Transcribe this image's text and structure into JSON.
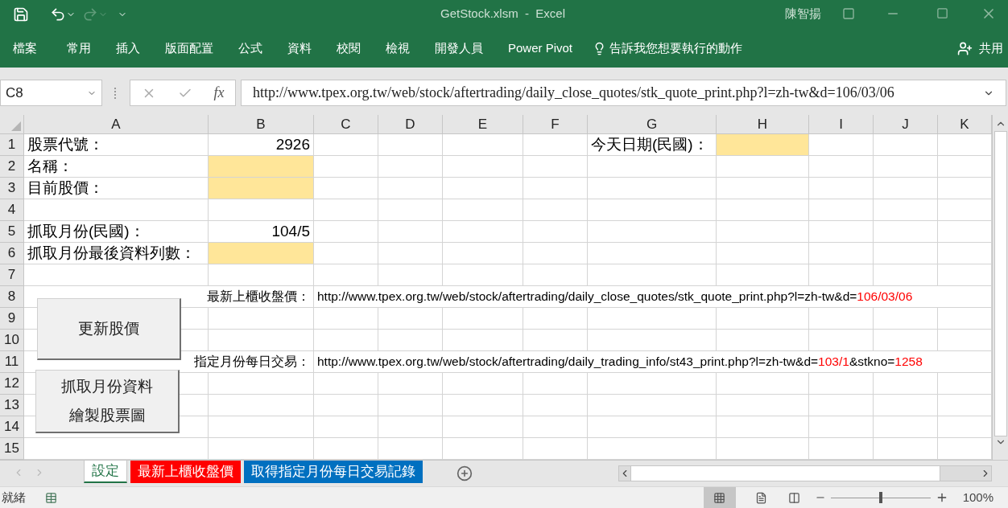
{
  "window": {
    "title": "GetStock.xlsm  -  Excel",
    "user": "陳智揚"
  },
  "ribbon_tabs": [
    {
      "label": "檔案"
    },
    {
      "label": "常用"
    },
    {
      "label": "插入"
    },
    {
      "label": "版面配置"
    },
    {
      "label": "公式"
    },
    {
      "label": "資料"
    },
    {
      "label": "校閱"
    },
    {
      "label": "檢視"
    },
    {
      "label": "開發人員"
    },
    {
      "label": "Power Pivot"
    }
  ],
  "tell_me": "告訴我您想要執行的動作",
  "share": "共用",
  "formula_bar": {
    "name_box": "C8",
    "function_label": "fx",
    "formula": "http://www.tpex.org.tw/web/stock/aftertrading/daily_close_quotes/stk_quote_print.php?l=zh-tw&d=106/03/06"
  },
  "columns": [
    "A",
    "B",
    "C",
    "D",
    "E",
    "F",
    "G",
    "H",
    "I",
    "J",
    "K"
  ],
  "rows": [
    {
      "label": "1",
      "cells": [
        {
          "kind": "text",
          "text": "股票代號："
        },
        {
          "kind": "number",
          "text": "2926"
        },
        {
          "kind": "empty"
        },
        {
          "kind": "empty"
        },
        {
          "kind": "empty"
        },
        {
          "kind": "empty"
        },
        {
          "kind": "text",
          "text": "今天日期(民國)："
        },
        {
          "kind": "filled"
        },
        {
          "kind": "empty"
        },
        {
          "kind": "empty"
        },
        {
          "kind": "empty"
        }
      ]
    },
    {
      "label": "2",
      "cells": [
        {
          "kind": "text",
          "text": "名稱："
        },
        {
          "kind": "filled"
        },
        {
          "kind": "empty"
        },
        {
          "kind": "empty"
        },
        {
          "kind": "empty"
        },
        {
          "kind": "empty"
        },
        {
          "kind": "empty"
        },
        {
          "kind": "empty"
        },
        {
          "kind": "empty"
        },
        {
          "kind": "empty"
        },
        {
          "kind": "empty"
        }
      ]
    },
    {
      "label": "3",
      "cells": [
        {
          "kind": "text",
          "text": "目前股價："
        },
        {
          "kind": "filled"
        },
        {
          "kind": "empty"
        },
        {
          "kind": "empty"
        },
        {
          "kind": "empty"
        },
        {
          "kind": "empty"
        },
        {
          "kind": "empty"
        },
        {
          "kind": "empty"
        },
        {
          "kind": "empty"
        },
        {
          "kind": "empty"
        },
        {
          "kind": "empty"
        }
      ]
    },
    {
      "label": "4",
      "cells": [
        {
          "kind": "empty"
        },
        {
          "kind": "empty"
        },
        {
          "kind": "empty"
        },
        {
          "kind": "empty"
        },
        {
          "kind": "empty"
        },
        {
          "kind": "empty"
        },
        {
          "kind": "empty"
        },
        {
          "kind": "empty"
        },
        {
          "kind": "empty"
        },
        {
          "kind": "empty"
        },
        {
          "kind": "empty"
        }
      ]
    },
    {
      "label": "5",
      "cells": [
        {
          "kind": "text",
          "text": "抓取月份(民國)："
        },
        {
          "kind": "number",
          "text": "104/5"
        },
        {
          "kind": "empty"
        },
        {
          "kind": "empty"
        },
        {
          "kind": "empty"
        },
        {
          "kind": "empty"
        },
        {
          "kind": "empty"
        },
        {
          "kind": "empty"
        },
        {
          "kind": "empty"
        },
        {
          "kind": "empty"
        },
        {
          "kind": "empty"
        }
      ]
    },
    {
      "label": "6",
      "cells": [
        {
          "kind": "text",
          "text": "抓取月份最後資料列數："
        },
        {
          "kind": "filled"
        },
        {
          "kind": "empty"
        },
        {
          "kind": "empty"
        },
        {
          "kind": "empty"
        },
        {
          "kind": "empty"
        },
        {
          "kind": "empty"
        },
        {
          "kind": "empty"
        },
        {
          "kind": "empty"
        },
        {
          "kind": "empty"
        },
        {
          "kind": "empty"
        }
      ]
    },
    {
      "label": "7",
      "cells": [
        {
          "kind": "empty"
        },
        {
          "kind": "empty"
        },
        {
          "kind": "empty"
        },
        {
          "kind": "empty"
        },
        {
          "kind": "empty"
        },
        {
          "kind": "empty"
        },
        {
          "kind": "empty"
        },
        {
          "kind": "empty"
        },
        {
          "kind": "empty"
        },
        {
          "kind": "empty"
        },
        {
          "kind": "empty"
        }
      ]
    },
    {
      "label": "8",
      "cells": [
        {
          "kind": "empty"
        },
        {
          "kind": "label",
          "text": "最新上櫃收盤價："
        },
        {
          "kind": "url",
          "segments": [
            {
              "text": "http://www.tpex.org.tw/web/stock/aftertrading/daily_close_quotes/stk_quote_print.php?l=zh-tw&d=",
              "red": false
            },
            {
              "text": "106/03/06",
              "red": true
            }
          ]
        },
        {
          "kind": "empty"
        },
        {
          "kind": "empty"
        },
        {
          "kind": "empty"
        },
        {
          "kind": "empty"
        },
        {
          "kind": "empty"
        },
        {
          "kind": "empty"
        },
        {
          "kind": "empty"
        },
        {
          "kind": "empty"
        }
      ]
    },
    {
      "label": "9",
      "cells": [
        {
          "kind": "empty"
        },
        {
          "kind": "empty"
        },
        {
          "kind": "empty"
        },
        {
          "kind": "empty"
        },
        {
          "kind": "empty"
        },
        {
          "kind": "empty"
        },
        {
          "kind": "empty"
        },
        {
          "kind": "empty"
        },
        {
          "kind": "empty"
        },
        {
          "kind": "empty"
        },
        {
          "kind": "empty"
        }
      ]
    },
    {
      "label": "10",
      "cells": [
        {
          "kind": "empty"
        },
        {
          "kind": "empty"
        },
        {
          "kind": "empty"
        },
        {
          "kind": "empty"
        },
        {
          "kind": "empty"
        },
        {
          "kind": "empty"
        },
        {
          "kind": "empty"
        },
        {
          "kind": "empty"
        },
        {
          "kind": "empty"
        },
        {
          "kind": "empty"
        },
        {
          "kind": "empty"
        }
      ]
    },
    {
      "label": "11",
      "cells": [
        {
          "kind": "empty"
        },
        {
          "kind": "label",
          "text": "指定月份每日交易："
        },
        {
          "kind": "url",
          "segments": [
            {
              "text": "http://www.tpex.org.tw/web/stock/aftertrading/daily_trading_info/st43_print.php?l=zh-tw&d=",
              "red": false
            },
            {
              "text": "103/1",
              "red": true
            },
            {
              "text": "&stkno=",
              "red": false
            },
            {
              "text": "1258",
              "red": true
            }
          ]
        },
        {
          "kind": "empty"
        },
        {
          "kind": "empty"
        },
        {
          "kind": "empty"
        },
        {
          "kind": "empty"
        },
        {
          "kind": "empty"
        },
        {
          "kind": "empty"
        },
        {
          "kind": "empty"
        },
        {
          "kind": "empty"
        }
      ]
    },
    {
      "label": "12",
      "cells": [
        {
          "kind": "empty"
        },
        {
          "kind": "empty"
        },
        {
          "kind": "empty"
        },
        {
          "kind": "empty"
        },
        {
          "kind": "empty"
        },
        {
          "kind": "empty"
        },
        {
          "kind": "empty"
        },
        {
          "kind": "empty"
        },
        {
          "kind": "empty"
        },
        {
          "kind": "empty"
        },
        {
          "kind": "empty"
        }
      ]
    },
    {
      "label": "13",
      "cells": [
        {
          "kind": "empty"
        },
        {
          "kind": "empty"
        },
        {
          "kind": "empty"
        },
        {
          "kind": "empty"
        },
        {
          "kind": "empty"
        },
        {
          "kind": "empty"
        },
        {
          "kind": "empty"
        },
        {
          "kind": "empty"
        },
        {
          "kind": "empty"
        },
        {
          "kind": "empty"
        },
        {
          "kind": "empty"
        }
      ]
    },
    {
      "label": "14",
      "cells": [
        {
          "kind": "empty"
        },
        {
          "kind": "empty"
        },
        {
          "kind": "empty"
        },
        {
          "kind": "empty"
        },
        {
          "kind": "empty"
        },
        {
          "kind": "empty"
        },
        {
          "kind": "empty"
        },
        {
          "kind": "empty"
        },
        {
          "kind": "empty"
        },
        {
          "kind": "empty"
        },
        {
          "kind": "empty"
        }
      ]
    },
    {
      "label": "15",
      "cells": [
        {
          "kind": "empty"
        },
        {
          "kind": "empty"
        },
        {
          "kind": "empty"
        },
        {
          "kind": "empty"
        },
        {
          "kind": "empty"
        },
        {
          "kind": "empty"
        },
        {
          "kind": "empty"
        },
        {
          "kind": "empty"
        },
        {
          "kind": "empty"
        },
        {
          "kind": "empty"
        },
        {
          "kind": "empty"
        }
      ]
    }
  ],
  "macro_buttons": [
    {
      "lines": [
        "更新股價"
      ]
    },
    {
      "lines": [
        "抓取月份資料",
        "繪製股票圖"
      ]
    }
  ],
  "sheet_tabs": [
    {
      "label": "設定",
      "selected": true,
      "color": "#ffffff"
    },
    {
      "label": "最新上櫃收盤價",
      "selected": false,
      "color": "#ff0000"
    },
    {
      "label": "取得指定月份每日交易記錄",
      "selected": false,
      "color": "#0070c0"
    }
  ],
  "status_bar": {
    "status": "就緒",
    "zoom": "100%",
    "zoom_slider": {
      "level": 0.5
    }
  }
}
